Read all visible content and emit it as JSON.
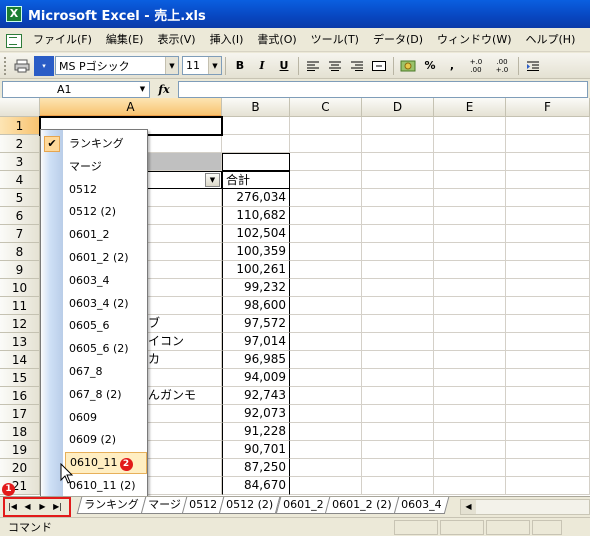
{
  "window": {
    "title": "Microsoft Excel - 売上.xls"
  },
  "menu": [
    "ファイル(F)",
    "編集(E)",
    "表示(V)",
    "挿入(I)",
    "書式(O)",
    "ツール(T)",
    "データ(D)",
    "ウィンドウ(W)",
    "ヘルプ(H)"
  ],
  "toolbar": {
    "font_name": "MS Pゴシック",
    "font_size": "11",
    "bold": "B",
    "italic": "I",
    "underline": "U",
    "percent": "%",
    "comma": ",",
    "inc_decimal": "+.0 .00",
    "dec_decimal": ".00 +.0"
  },
  "formula_bar": {
    "name_box": "A1",
    "fx_label": "fx",
    "formula": ""
  },
  "columns": [
    "A",
    "B",
    "C",
    "D",
    "E",
    "F"
  ],
  "rows": [
    "1",
    "2",
    "3",
    "4",
    "5",
    "6",
    "7",
    "8",
    "9",
    "10",
    "11",
    "12",
    "13",
    "14",
    "15",
    "16",
    "17",
    "18",
    "19",
    "20",
    "21"
  ],
  "header_total": "合計",
  "totals": [
    "276,034",
    "110,682",
    "102,504",
    "100,359",
    "100,261",
    "99,232",
    "98,600",
    "97,572",
    "97,014",
    "96,985",
    "94,009",
    "92,743",
    "92,073",
    "91,228",
    "90,701",
    "87,250",
    "84,670"
  ],
  "partial_col_a": {
    "r12": "ブ",
    "r13": "イコン",
    "r14": "カ",
    "r16": "んガンモ"
  },
  "sheet_list": {
    "items": [
      "ランキング",
      "マージ",
      "0512",
      "0512 (2)",
      "0601_2",
      "0601_2 (2)",
      "0603_4",
      "0603_4 (2)",
      "0605_6",
      "0605_6 (2)",
      "067_8",
      "067_8 (2)",
      "0609",
      "0609 (2)",
      "0610_11",
      "0610_11 (2)"
    ],
    "checked": "ランキング",
    "hover": "0610_11",
    "badge_2": "2"
  },
  "tabs": [
    "ランキング",
    "マージ",
    "0512",
    "0512 (2)",
    "0601_2",
    "0601_2 (2)",
    "0603_4"
  ],
  "nav_badge": "1",
  "status": {
    "text": "コマンド"
  }
}
